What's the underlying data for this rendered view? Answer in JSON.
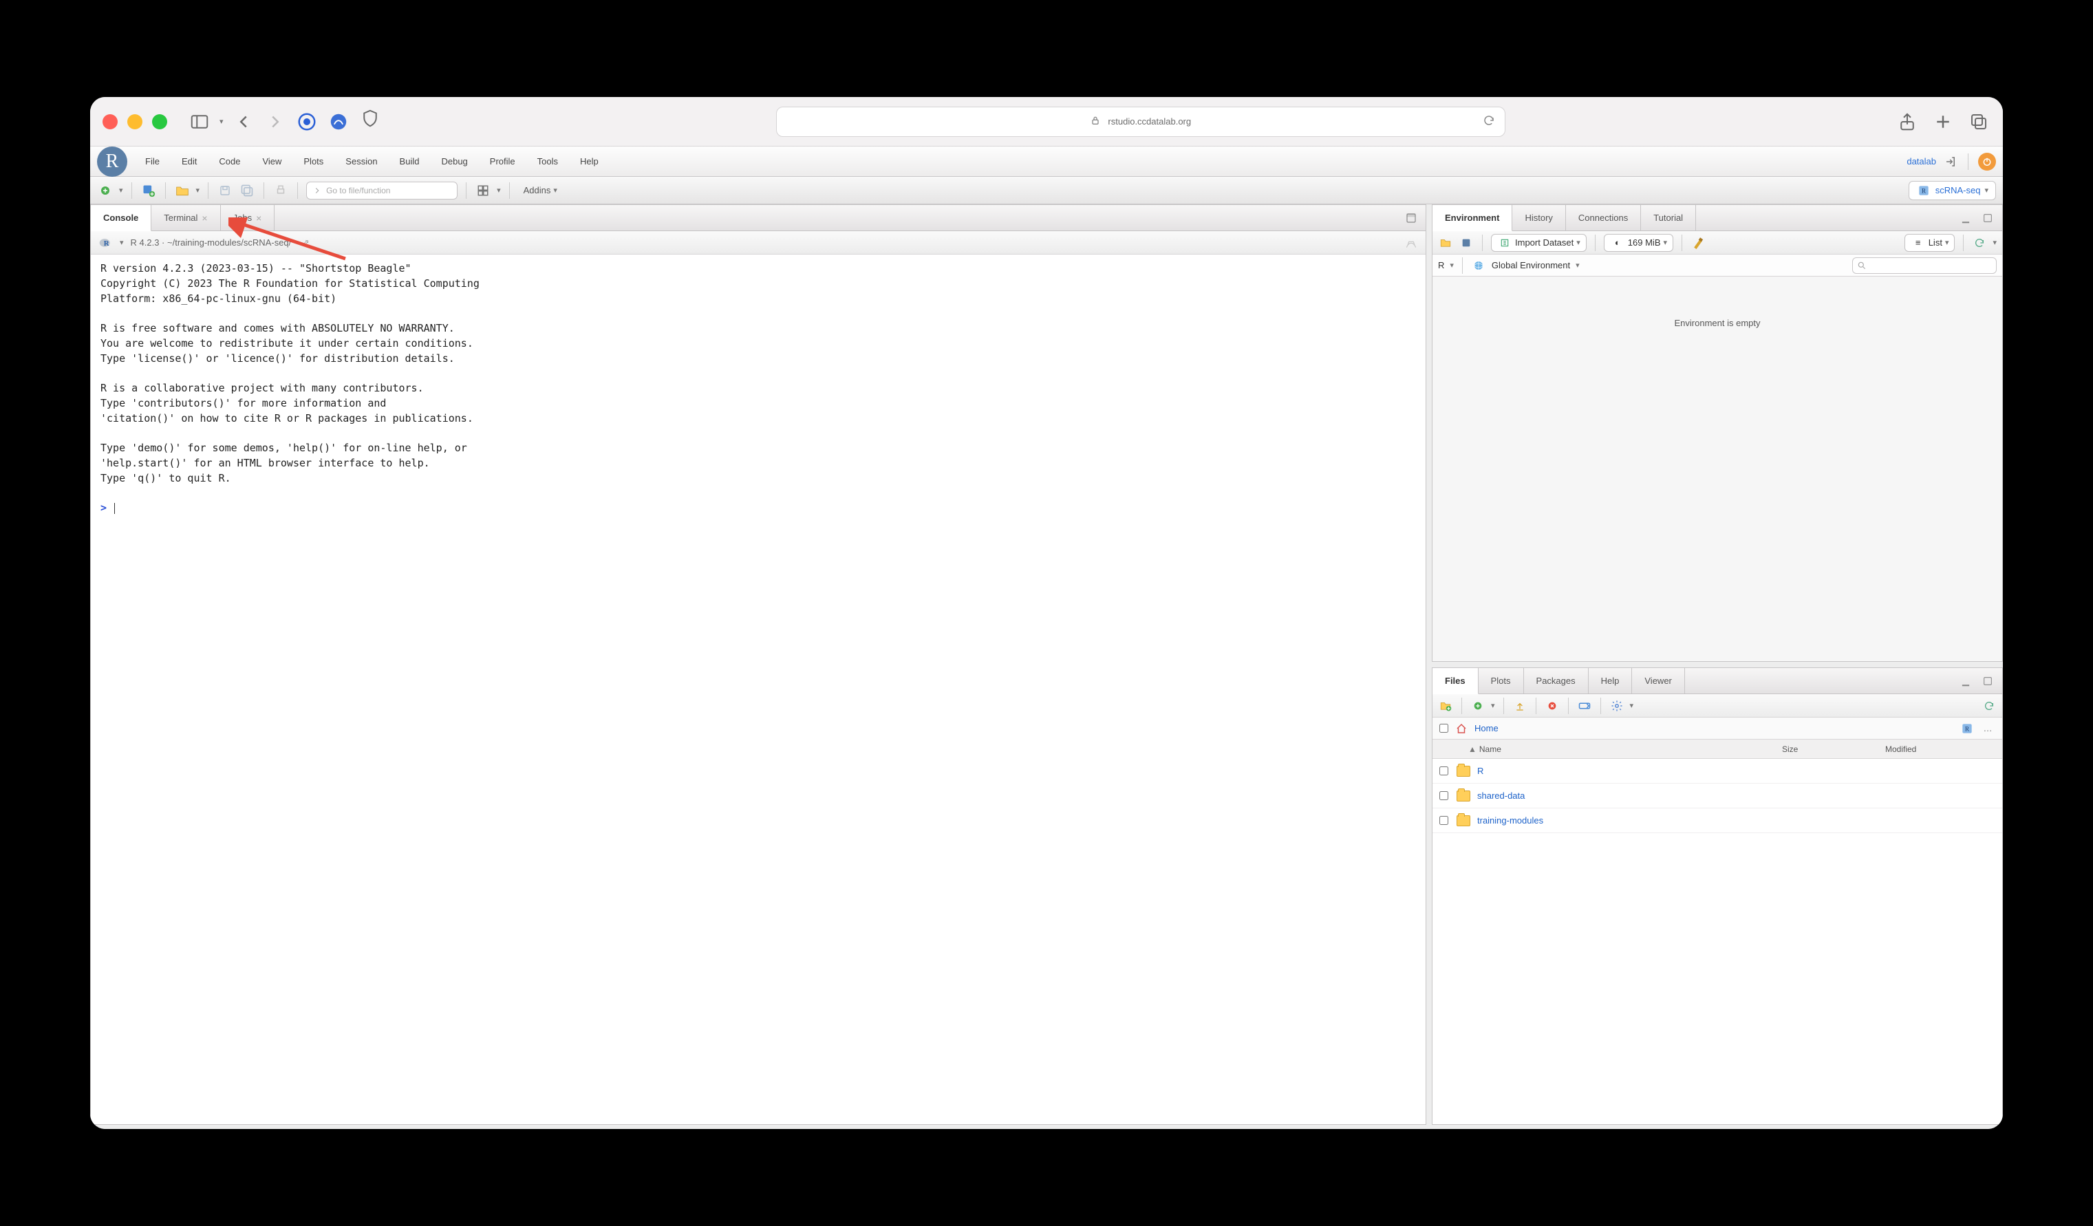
{
  "browser": {
    "url": "rstudio.ccdatalab.org"
  },
  "menubar": {
    "items": [
      "File",
      "Edit",
      "Code",
      "View",
      "Plots",
      "Session",
      "Build",
      "Debug",
      "Profile",
      "Tools",
      "Help"
    ],
    "user": "datalab"
  },
  "toolbar": {
    "goto_placeholder": "Go to file/function",
    "addins": "Addins",
    "project": "scRNA-seq"
  },
  "console": {
    "tabs": {
      "console": "Console",
      "terminal": "Terminal",
      "jobs": "Jobs"
    },
    "version_line": "R 4.2.3 · ~/training-modules/scRNA-seq/",
    "banner": "R version 4.2.3 (2023-03-15) -- \"Shortstop Beagle\"\nCopyright (C) 2023 The R Foundation for Statistical Computing\nPlatform: x86_64-pc-linux-gnu (64-bit)\n\nR is free software and comes with ABSOLUTELY NO WARRANTY.\nYou are welcome to redistribute it under certain conditions.\nType 'license()' or 'licence()' for distribution details.\n\nR is a collaborative project with many contributors.\nType 'contributors()' for more information and\n'citation()' on how to cite R or R packages in publications.\n\nType 'demo()' for some demos, 'help()' for on-line help, or\n'help.start()' for an HTML browser interface to help.\nType 'q()' to quit R.\n",
    "prompt": ">"
  },
  "env": {
    "tabs": {
      "environment": "Environment",
      "history": "History",
      "connections": "Connections",
      "tutorial": "Tutorial"
    },
    "import": "Import Dataset",
    "mem": "169 MiB",
    "list": "List",
    "lang": "R",
    "scope": "Global Environment",
    "empty": "Environment is empty"
  },
  "files": {
    "tabs": {
      "files": "Files",
      "plots": "Plots",
      "packages": "Packages",
      "help": "Help",
      "viewer": "Viewer"
    },
    "home": "Home",
    "cols": {
      "name": "Name",
      "size": "Size",
      "modified": "Modified"
    },
    "rows": [
      {
        "name": "R"
      },
      {
        "name": "shared-data"
      },
      {
        "name": "training-modules"
      }
    ]
  }
}
